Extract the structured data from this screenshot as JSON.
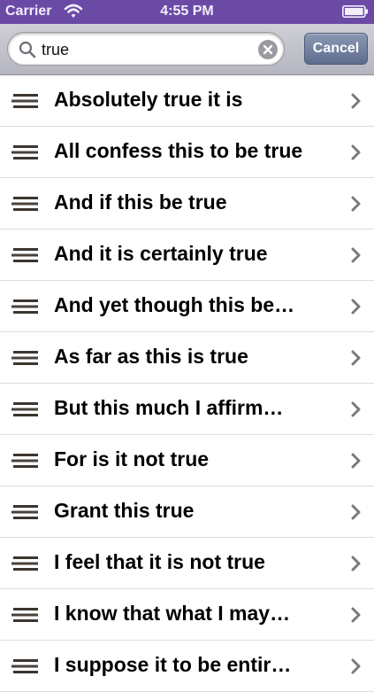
{
  "status_bar": {
    "carrier": "Carrier",
    "time": "4:55 PM",
    "background": "#6b4aa6"
  },
  "search": {
    "value": "true",
    "cancel_label": "Cancel"
  },
  "results": [
    "Absolutely true it is",
    "All confess this to be true",
    "And if this be true",
    "And it is certainly true",
    "And yet though this be…",
    "As far as this is true",
    "But this much I affirm…",
    "For is it not true",
    "Grant this true",
    "I feel that it is not true",
    "I know that what I may…",
    "I suppose it to be entir…"
  ],
  "icons": {
    "row_icon": "lines-icon",
    "disclosure": "chevron-right-icon"
  }
}
